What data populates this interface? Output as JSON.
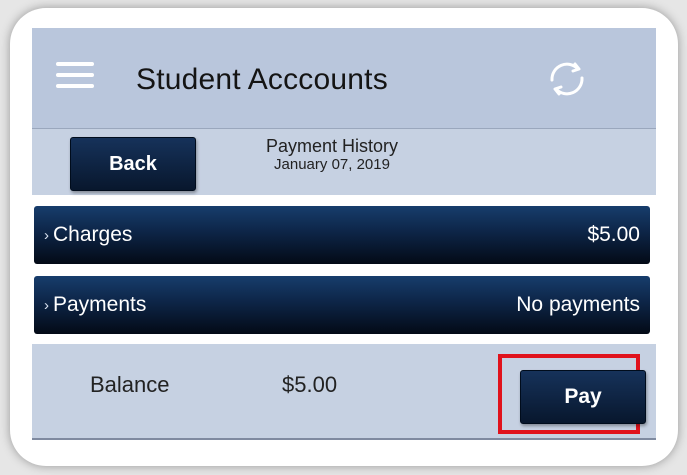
{
  "header": {
    "title": "Student Acccounts",
    "menu_icon": "hamburger-menu-icon",
    "refresh_icon": "refresh-icon"
  },
  "subbar": {
    "back_label": "Back",
    "heading": "Payment History",
    "date": "January 07, 2019"
  },
  "rows": [
    {
      "label": "Charges",
      "value": "$5.00",
      "chevron": "›"
    },
    {
      "label": "Payments",
      "value": "No payments",
      "chevron": "›"
    }
  ],
  "balance": {
    "label": "Balance",
    "value": "$5.00",
    "pay_label": "Pay"
  },
  "colors": {
    "header_bg": "#b9c6dc",
    "button_navy": "#0d2547",
    "highlight_red": "#e0121c"
  }
}
